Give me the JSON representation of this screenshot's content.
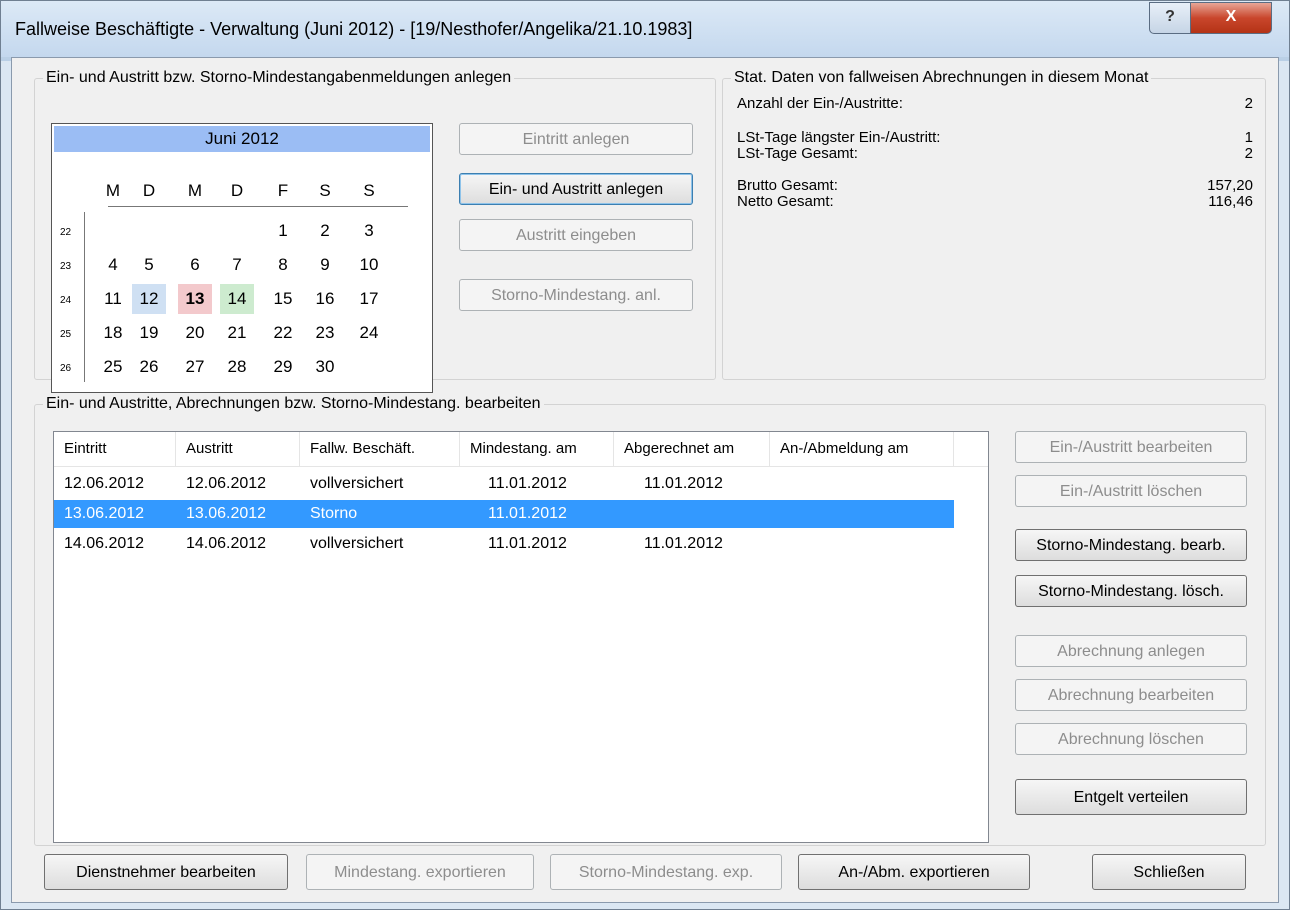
{
  "window": {
    "title": "Fallweise Beschäftigte - Verwaltung (Juni 2012) - [19/Nesthofer/Angelika/21.10.1983]",
    "help_glyph": "?",
    "close_glyph": "X"
  },
  "entry_group": {
    "title": "Ein- und Austritt bzw. Storno-Mindestangabenmeldungen anlegen",
    "buttons": {
      "eintritt": "Eintritt anlegen",
      "ein_austritt": "Ein- und Austritt anlegen",
      "austritt": "Austritt eingeben",
      "storno": "Storno-Mindestang. anl."
    }
  },
  "calendar": {
    "month": "Juni 2012",
    "weekdays": [
      "M",
      "D",
      "M",
      "D",
      "F",
      "S",
      "S"
    ],
    "weeks": [
      {
        "wk": "22",
        "days": [
          "",
          "",
          "",
          "",
          "1",
          "2",
          "3"
        ]
      },
      {
        "wk": "23",
        "days": [
          "4",
          "5",
          "6",
          "7",
          "8",
          "9",
          "10"
        ]
      },
      {
        "wk": "24",
        "days": [
          "11",
          "12",
          "13",
          "14",
          "15",
          "16",
          "17"
        ]
      },
      {
        "wk": "25",
        "days": [
          "18",
          "19",
          "20",
          "21",
          "22",
          "23",
          "24"
        ]
      },
      {
        "wk": "26",
        "days": [
          "25",
          "26",
          "27",
          "28",
          "29",
          "30",
          ""
        ]
      }
    ],
    "colors": {
      "blue": "#cfe0f3",
      "red": "#f3c9cc",
      "green": "#cdebcf",
      "header": "#9bbdf4"
    }
  },
  "stats": {
    "title": "Stat. Daten von fallweisen Abrechnungen in diesem Monat",
    "rows": [
      {
        "label": "Anzahl der Ein-/Austritte:",
        "value": "2"
      },
      {
        "label": "LSt-Tage längster Ein-/Austritt:",
        "value": "1"
      },
      {
        "label": "LSt-Tage Gesamt:",
        "value": "2"
      },
      {
        "label": "Brutto Gesamt:",
        "value": "157,20"
      },
      {
        "label": "Netto Gesamt:",
        "value": "116,46"
      }
    ]
  },
  "edit_group": {
    "title": "Ein- und Austritte, Abrechnungen bzw. Storno-Mindestang. bearbeiten",
    "columns": [
      "Eintritt",
      "Austritt",
      "Fallw. Beschäft.",
      "Mindestang. am",
      "Abgerechnet am",
      "An-/Abmeldung am"
    ],
    "rows": [
      {
        "cells": [
          "12.06.2012",
          "12.06.2012",
          "vollversichert",
          "11.01.2012",
          "11.01.2012",
          ""
        ]
      },
      {
        "cells": [
          "13.06.2012",
          "13.06.2012",
          "Storno",
          "11.01.2012",
          "",
          ""
        ]
      },
      {
        "cells": [
          "14.06.2012",
          "14.06.2012",
          "vollversichert",
          "11.01.2012",
          "11.01.2012",
          ""
        ]
      }
    ],
    "selection_color": "#3399ff",
    "buttons": {
      "ein_austritt_bearbeiten": "Ein-/Austritt bearbeiten",
      "ein_austritt_loeschen": "Ein-/Austritt löschen",
      "storno_bearb": "Storno-Mindestang. bearb.",
      "storno_loesch": "Storno-Mindestang. lösch.",
      "abrechnung_anlegen": "Abrechnung anlegen",
      "abrechnung_bearbeiten": "Abrechnung bearbeiten",
      "abrechnung_loeschen": "Abrechnung löschen",
      "entgelt_verteilen": "Entgelt verteilen"
    }
  },
  "footer": {
    "dienstnehmer": "Dienstnehmer bearbeiten",
    "mindestang_export": "Mindestang. exportieren",
    "storno_export": "Storno-Mindestang. exp.",
    "anabm_export": "An-/Abm. exportieren",
    "schliessen": "Schließen"
  }
}
